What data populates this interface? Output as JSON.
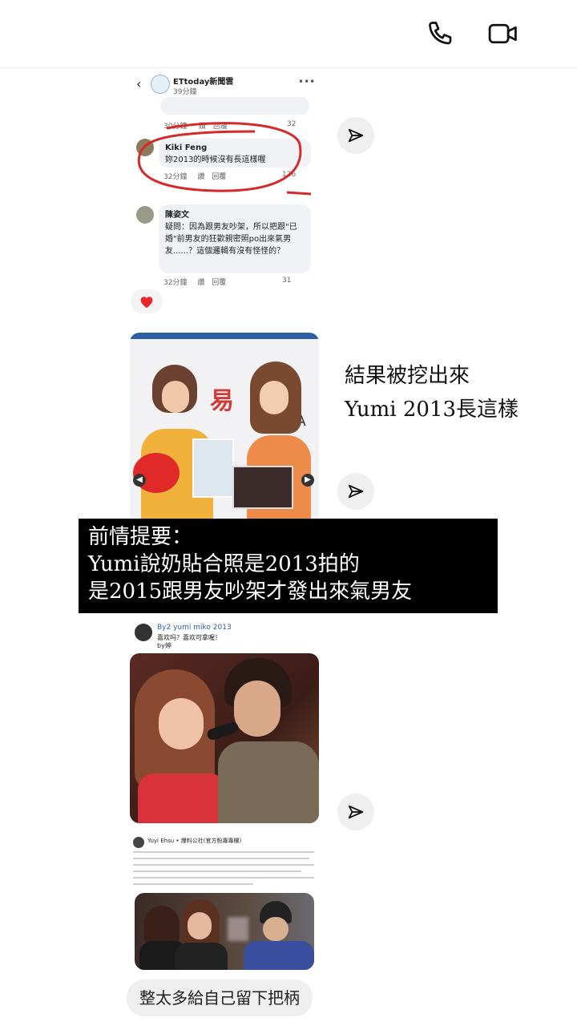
{
  "header": {
    "call_icon": "phone-icon",
    "video_icon": "video-camera-icon"
  },
  "fb_post": {
    "page_name": "ETtoday新聞雲",
    "time": "39分鐘",
    "comments": [
      {
        "stub_time": "30分鐘",
        "stub_like": "讚",
        "stub_reply": "回覆",
        "stub_count": "32"
      },
      {
        "author": "Kiki Feng",
        "text": "妳2013的時候沒有長這樣喔",
        "time": "32分鐘",
        "like": "讚",
        "reply": "回覆",
        "count": "126"
      },
      {
        "author": "陳姿文",
        "text": "疑問：因為跟男友吵架，所以把跟\"已婚\"前男友的狂歡親密照po出來氣男友......？這個邏輯有沒有怪怪的？",
        "time": "32分鐘",
        "like": "讚",
        "reply": "回覆",
        "count": "31"
      }
    ],
    "reaction": "heart"
  },
  "side_caption": {
    "line1": "結果被挖出來",
    "line2": "Yumi 2013長這樣"
  },
  "overlay_caption": {
    "line1": "前情提要：",
    "line2": "Yumi說奶貼合照是2013拍的",
    "line3": "是2015跟男友吵架才發出來氣男友"
  },
  "photo2_post": {
    "author": "By2 yumi miko 2013",
    "text1": "喜欢吗？喜欢可拿喔！",
    "text2": "by婷"
  },
  "photo3_post": {
    "author": "Yuyi Ehsu • 爆料公社(官方粉專專欄)"
  },
  "last_message": {
    "text": "整太多給自己留下把柄"
  },
  "colors": {
    "accent_red": "#d62a2a",
    "bubble_gray": "#efefef",
    "caption_bg": "#000000"
  }
}
